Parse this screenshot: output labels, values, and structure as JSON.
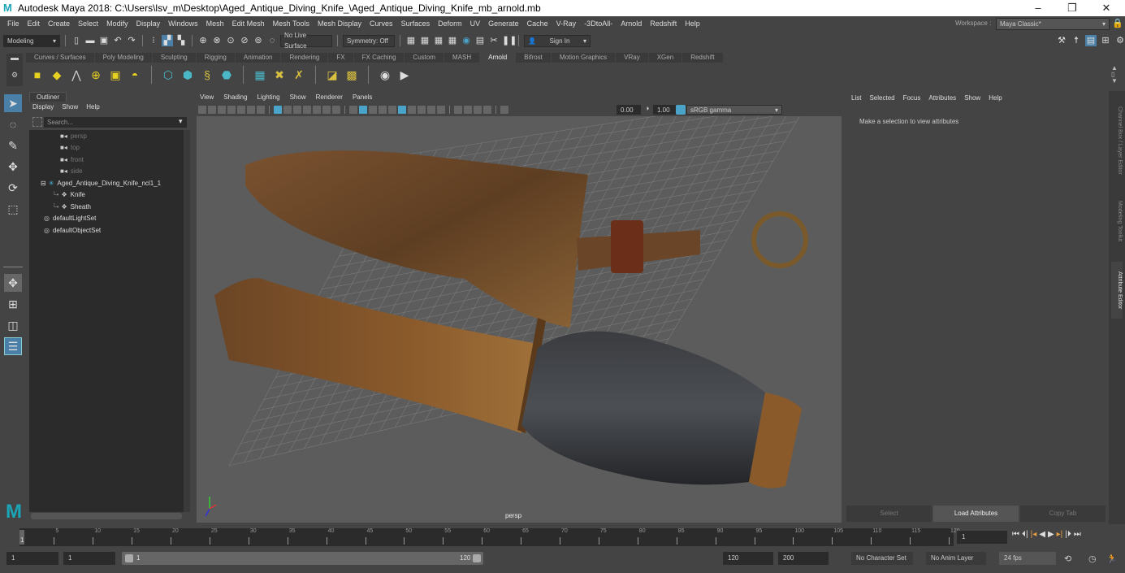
{
  "window": {
    "title": "Autodesk Maya 2018: C:\\Users\\lsv_m\\Desktop\\Aged_Antique_Diving_Knife_\\Aged_Antique_Diving_Knife_mb_arnold.mb",
    "logo": "M",
    "controls": {
      "minimize": "–",
      "restore": "❐",
      "close": "✕"
    }
  },
  "menubar": {
    "items": [
      "File",
      "Edit",
      "Create",
      "Select",
      "Modify",
      "Display",
      "Windows",
      "Mesh",
      "Edit Mesh",
      "Mesh Tools",
      "Mesh Display",
      "Curves",
      "Surfaces",
      "Deform",
      "UV",
      "Generate",
      "Cache",
      "V-Ray",
      "-3DtoAll-",
      "Arnold",
      "Redshift",
      "Help"
    ],
    "workspace_label": "Workspace :",
    "workspace_value": "Maya Classic*"
  },
  "statusline": {
    "mode": "Modeling",
    "live_surface": "No Live Surface",
    "symmetry": "Symmetry: Off",
    "sign_in": "Sign In"
  },
  "shelf": {
    "tabs": [
      "Curves / Surfaces",
      "Poly Modeling",
      "Sculpting",
      "Rigging",
      "Animation",
      "Rendering",
      "FX",
      "FX Caching",
      "Custom",
      "MASH",
      "Arnold",
      "Bifrost",
      "Motion Graphics",
      "VRay",
      "XGen",
      "Redshift"
    ],
    "active_tab": "Arnold",
    "icons": [
      "area-light-icon",
      "mesh-light-icon",
      "photometric-light-icon",
      "skydome-light-icon",
      "light-portal-icon",
      "physical-sky-icon",
      "standin-create-icon",
      "standin-export-icon",
      "curve-collector-icon",
      "volume-icon",
      "render-view-icon",
      "texture-tx-icon",
      "texture-remove-icon",
      "shader-icon",
      "aov-icon",
      "ipr-icon",
      "render-icon"
    ]
  },
  "outliner": {
    "tab": "Outliner",
    "menu": [
      "Display",
      "Show",
      "Help"
    ],
    "search_placeholder": "Search...",
    "items": [
      {
        "label": "persp",
        "type": "camera",
        "dim": true,
        "indent": 0
      },
      {
        "label": "top",
        "type": "camera",
        "dim": true,
        "indent": 0
      },
      {
        "label": "front",
        "type": "camera",
        "dim": true,
        "indent": 0
      },
      {
        "label": "side",
        "type": "camera",
        "dim": true,
        "indent": 0
      },
      {
        "label": "Aged_Antique_Diving_Knife_ncl1_1",
        "type": "group",
        "dim": false,
        "indent": 0,
        "expanded": true
      },
      {
        "label": "Knife",
        "type": "mesh",
        "dim": false,
        "indent": 1
      },
      {
        "label": "Sheath",
        "type": "mesh",
        "dim": false,
        "indent": 1
      },
      {
        "label": "defaultLightSet",
        "type": "set",
        "dim": false,
        "indent": 0
      },
      {
        "label": "defaultObjectSet",
        "type": "set",
        "dim": false,
        "indent": 0
      }
    ]
  },
  "viewport": {
    "menu": [
      "View",
      "Shading",
      "Lighting",
      "Show",
      "Renderer",
      "Panels"
    ],
    "exposure": "0.00",
    "gamma": "1.00",
    "color_space": "sRGB gamma",
    "camera_label": "persp"
  },
  "attribute_editor": {
    "menu": [
      "List",
      "Selected",
      "Focus",
      "Attributes",
      "Show",
      "Help"
    ],
    "message": "Make a selection to view attributes",
    "buttons": [
      "Select",
      "Load Attributes",
      "Copy Tab"
    ]
  },
  "side_tabs": [
    "Channel Box / Layer Editor",
    "Modeling Toolkit",
    "Attribute Editor"
  ],
  "timeline": {
    "ticks": [
      5,
      10,
      15,
      20,
      25,
      30,
      35,
      40,
      45,
      50,
      55,
      60,
      65,
      70,
      75,
      80,
      85,
      90,
      95,
      100,
      105,
      110,
      115,
      120
    ],
    "current_frame": "1",
    "current_marker": "1"
  },
  "range": {
    "start": "1",
    "playback_start": "1",
    "slider_start": "1",
    "slider_end": "120",
    "playback_end": "120",
    "end": "200",
    "character_set": "No Character Set",
    "anim_layer": "No Anim Layer",
    "fps": "24 fps"
  },
  "colors": {
    "accent": "#4aa3c8",
    "maya_logo": "#1aa6b7",
    "bronze": "#8a5a2b",
    "grip": "#2e3033"
  }
}
